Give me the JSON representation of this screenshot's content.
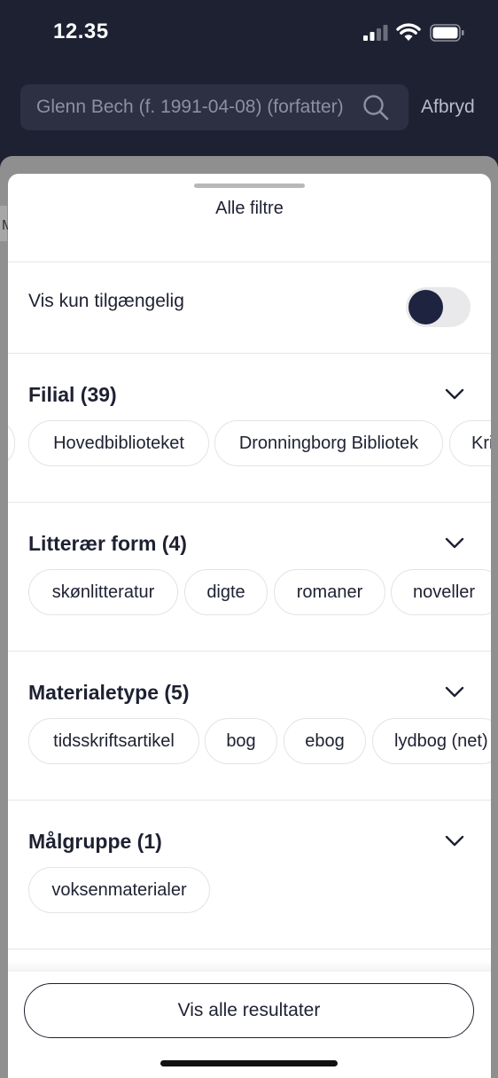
{
  "status": {
    "time": "12.35"
  },
  "search": {
    "query": "Glenn Bech (f. 1991-04-08) (forfatter)",
    "cancel_label": "Afbryd"
  },
  "background": {
    "partial_char": "M"
  },
  "sheet": {
    "title": "Alle filtre",
    "availability_toggle": {
      "label": "Vis kun tilgængelig",
      "on": false
    },
    "sections": [
      {
        "title": "Filial (39)",
        "chips": [
          "",
          "Hovedbiblioteket",
          "Dronningborg Bibliotek",
          "Kri"
        ]
      },
      {
        "title": "Litterær form (4)",
        "chips": [
          "skønlitteratur",
          "digte",
          "romaner",
          "noveller"
        ]
      },
      {
        "title": "Materialetype (5)",
        "chips": [
          "tidsskriftsartikel",
          "bog",
          "ebog",
          "lydbog (net)"
        ]
      },
      {
        "title": "Målgruppe (1)",
        "chips": [
          "voksenmaterialer"
        ]
      }
    ],
    "show_results_label": "Vis alle resultater"
  },
  "colors": {
    "header_bg": "#1e2132",
    "knob": "#1e2440",
    "chip_border": "#e3e3e8"
  }
}
